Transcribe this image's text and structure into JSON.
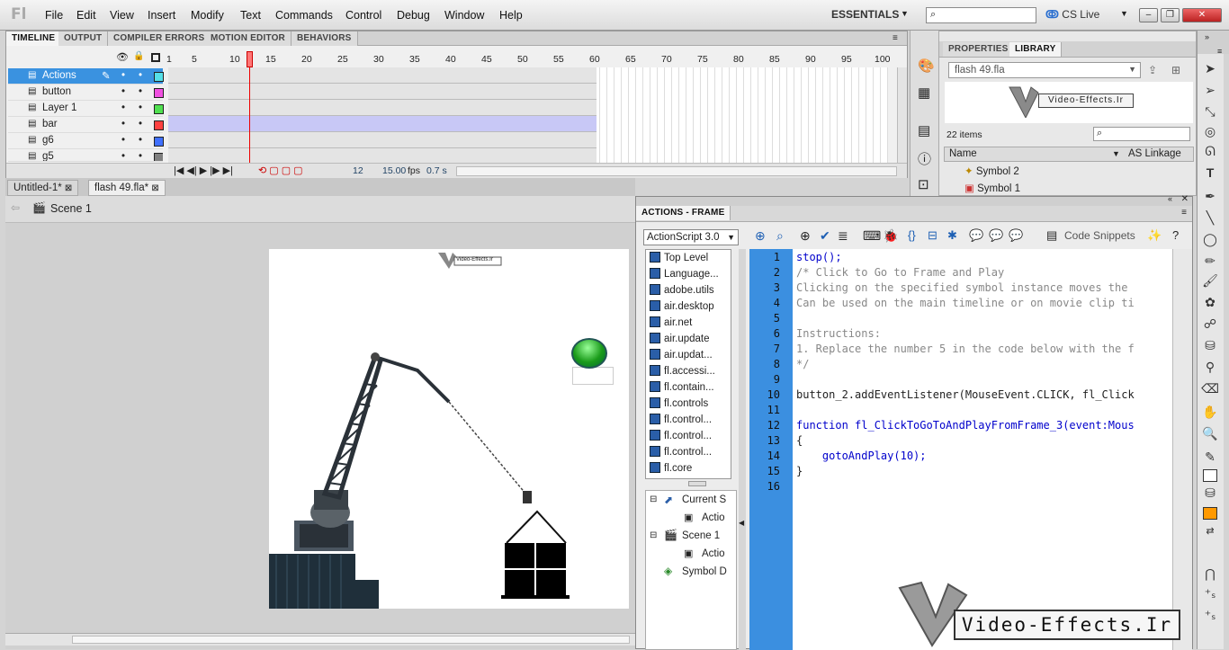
{
  "app": {
    "logo": "Fl"
  },
  "menu": [
    "File",
    "Edit",
    "View",
    "Insert",
    "Modify",
    "Text",
    "Commands",
    "Control",
    "Debug",
    "Window",
    "Help"
  ],
  "workspace": "ESSENTIALS",
  "cslive": "CS Live",
  "timeline": {
    "tabs": [
      "TIMELINE",
      "OUTPUT",
      "COMPILER ERRORS",
      "MOTION EDITOR",
      "BEHAVIORS"
    ],
    "layers": [
      "Actions",
      "button",
      "Layer 1",
      "bar",
      "g6",
      "g5"
    ],
    "layer_colors": [
      "#55e0e8",
      "#f050e0",
      "#50e050",
      "#ff4040",
      "#4070ff",
      "#808080"
    ],
    "frame_numbers": [
      "1",
      "5",
      "10",
      "15",
      "20",
      "25",
      "30",
      "35",
      "40",
      "45",
      "50",
      "55",
      "60",
      "65",
      "70",
      "75",
      "80",
      "85",
      "90",
      "95",
      "100"
    ],
    "status": {
      "frame": "12",
      "fps": "15.00",
      "fps_label": "fps",
      "time": "0.7 s"
    }
  },
  "docs": {
    "tabs": [
      "Untitled-1*",
      "flash 49.fla*"
    ],
    "scene": "Scene 1"
  },
  "right_panel": {
    "tabs": [
      "PROPERTIES",
      "LIBRARY"
    ],
    "file": "flash 49.fla",
    "banner": "Video-Effects.Ir",
    "count": "22 items",
    "cols": [
      "Name",
      "AS Linkage"
    ],
    "items": [
      "Symbol 2",
      "Symbol 1"
    ]
  },
  "actions": {
    "title": "ACTIONS - FRAME",
    "version": "ActionScript 3.0",
    "code_snippets": "Code Snippets",
    "packages": [
      "Top Level",
      "Language...",
      "adobe.utils",
      "air.desktop",
      "air.net",
      "air.update",
      "air.updat...",
      "fl.accessi...",
      "fl.contain...",
      "fl.controls",
      "fl.control...",
      "fl.control...",
      "fl.control...",
      "fl.core"
    ],
    "tree": [
      "Current S",
      "Actio",
      "Scene 1",
      "Actio",
      "Symbol D"
    ],
    "lines": [
      "stop();",
      "/* Click to Go to Frame and Play",
      "Clicking on the specified symbol instance moves the",
      "Can be used on the main timeline or on movie clip ti",
      "",
      "Instructions:",
      "1. Replace the number 5 in the code below with the f",
      "*/",
      "",
      "button_2.addEventListener(MouseEvent.CLICK, fl_Click",
      "",
      "function fl_ClickToGoToAndPlayFromFrame_3(event:Mous",
      "{",
      "    gotoAndPlay(10);",
      "}",
      ""
    ],
    "line_numbers": [
      "1",
      "2",
      "3",
      "4",
      "5",
      "6",
      "7",
      "8",
      "9",
      "10",
      "11",
      "12",
      "13",
      "14",
      "15",
      "16"
    ]
  },
  "watermark": "Video-Effects.Ir",
  "stage_logo_text": "Video-Effects.Ir"
}
